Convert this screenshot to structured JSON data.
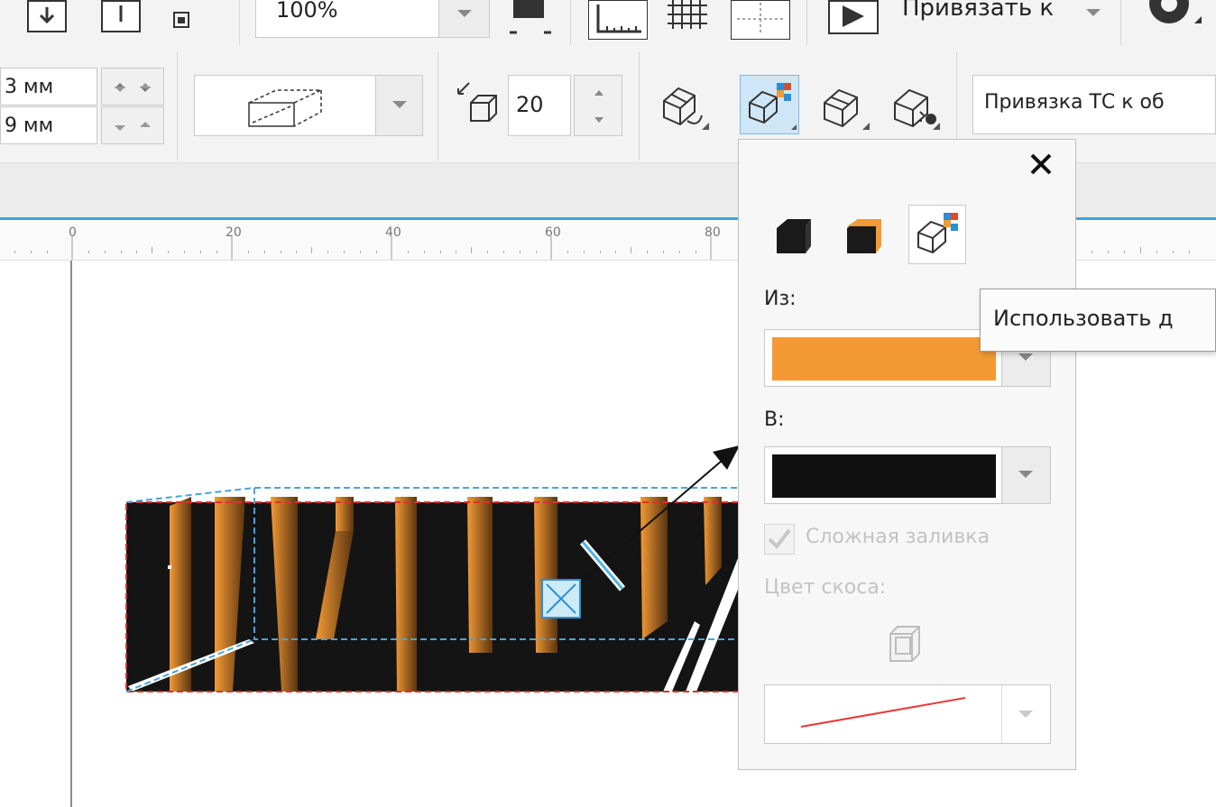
{
  "toolbar_top": {
    "zoom_value": "100%",
    "snap_label": "Привязать к"
  },
  "property_bar": {
    "coord_x": "3 мм",
    "coord_y": "9 мм",
    "depth_value": "20",
    "vanishing_point_dropdown": "Привязка ТС к об"
  },
  "ruler": {
    "ticks": [
      "0",
      "20",
      "40",
      "60",
      "80"
    ]
  },
  "canvas": {
    "artwork_text": "МАШИ"
  },
  "panel": {
    "from_label": "Из:",
    "from_color": "#f39a35",
    "to_label": "В:",
    "to_color": "#111111",
    "complex_fill_label": "Сложная заливка",
    "bevel_color_label": "Цвет скоса:",
    "bevel_line_color": "#e83a3a"
  },
  "tooltip": {
    "text": "Использовать д"
  },
  "colors": {
    "accent": "#3ba4e0",
    "extrude_orange": "#f39a35",
    "extrude_dark": "#111111"
  }
}
